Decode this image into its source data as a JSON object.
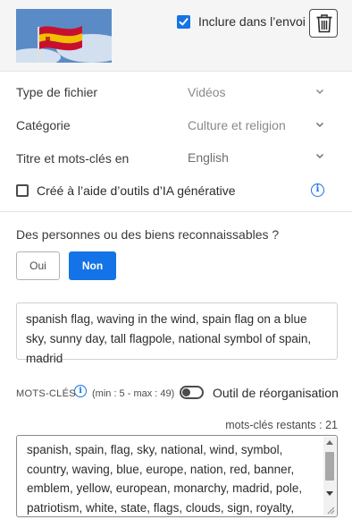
{
  "header": {
    "include_label": "Inclure dans l’envoi",
    "include_checked": true,
    "trash_icon": "trash-icon",
    "thumbnail": "spanish-flag-thumbnail"
  },
  "fields": {
    "file_type": {
      "label": "Type de fichier",
      "value": "Vidéos"
    },
    "category": {
      "label": "Catégorie",
      "value": "Culture et religion"
    },
    "title_lang": {
      "label": "Titre et mots-clés en",
      "value": "English"
    }
  },
  "ai": {
    "label": "Créé à l’aide d’outils d’IA générative",
    "checked": false
  },
  "people": {
    "question": "Des personnes ou des biens reconnaissables ?",
    "yes": "Oui",
    "no": "Non",
    "selected": "Non"
  },
  "title": {
    "text": "spanish flag, waving in the wind, spain flag on a blue sky, sunny day, tall flagpole, national symbol of spain, madrid"
  },
  "keywords": {
    "label": "MOTS-CLÉS",
    "range": "(min : 5 - max : 49)",
    "toggle_label": "Outil de réorganisation",
    "toggle_on": false,
    "remaining": "mots-clés restants : 21",
    "text": "spanish, spain, flag, sky, national, wind, symbol, country, waving, blue, europe, nation, red, banner, emblem, yellow, european, monarchy, madrid, pole, patriotism, white, state, flags, clouds, sign, royalty, waving in the"
  },
  "colors": {
    "accent": "#1473e6",
    "header_bg": "#f5f5f5",
    "flag_red": "#c8102e",
    "flag_yellow": "#f1bf00"
  }
}
